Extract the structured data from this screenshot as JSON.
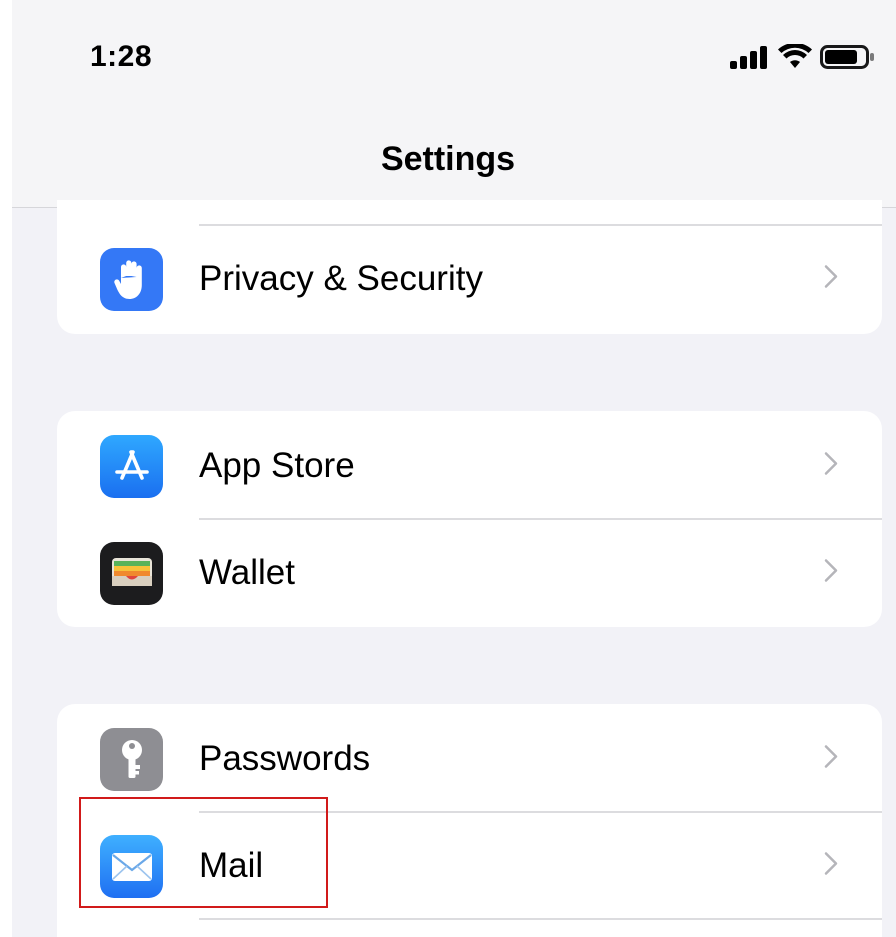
{
  "status_bar": {
    "time": "1:28"
  },
  "nav": {
    "title": "Settings"
  },
  "groups": [
    {
      "items": [
        {
          "label": "Privacy & Security",
          "icon": "hand-icon",
          "color": "#3478f6"
        }
      ]
    },
    {
      "items": [
        {
          "label": "App Store",
          "icon": "app-store-icon",
          "color": "#1e8cf5"
        },
        {
          "label": "Wallet",
          "icon": "wallet-icon",
          "color": "#1c1c1e"
        }
      ]
    },
    {
      "items": [
        {
          "label": "Passwords",
          "icon": "key-icon",
          "color": "#8e8e93"
        },
        {
          "label": "Mail",
          "icon": "mail-icon",
          "color": "#2f8cf7"
        }
      ]
    }
  ],
  "colors": {
    "background": "#f2f2f7",
    "accent": "#3478f6",
    "highlight": "#d11a1a"
  }
}
